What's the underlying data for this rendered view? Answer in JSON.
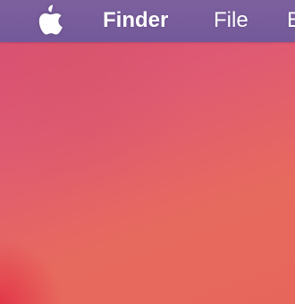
{
  "menubar": {
    "apple_icon": "apple-logo-icon",
    "items": [
      {
        "label": "Finder",
        "active_app": true
      },
      {
        "label": "File"
      },
      {
        "label": "E"
      }
    ]
  },
  "colors": {
    "menubar_bg": "#7a5f9e",
    "menubar_text": "#ffffff",
    "wallpaper_top": "#d94a78",
    "wallpaper_bottom": "#e7665c"
  }
}
